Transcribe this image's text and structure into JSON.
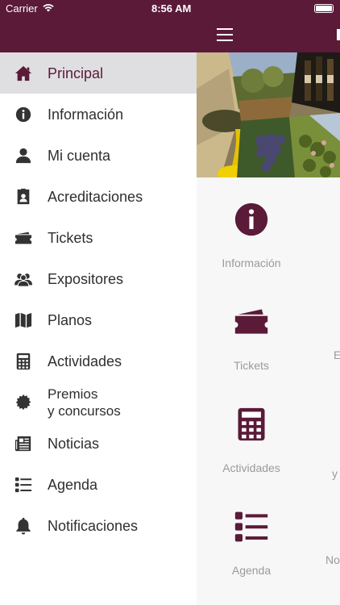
{
  "status_bar": {
    "carrier": "Carrier",
    "time": "8:56 AM"
  },
  "drawer": {
    "items": [
      {
        "label": "Principal",
        "icon": "home-icon",
        "active": true
      },
      {
        "label": "Información",
        "icon": "info-icon"
      },
      {
        "label": "Mi cuenta",
        "icon": "user-icon"
      },
      {
        "label": "Acreditaciones",
        "icon": "badge-icon"
      },
      {
        "label": "Tickets",
        "icon": "ticket-icon"
      },
      {
        "label": "Expositores",
        "icon": "group-icon"
      },
      {
        "label": "Planos",
        "icon": "map-icon"
      },
      {
        "label": "Actividades",
        "icon": "calculator-icon"
      },
      {
        "label_line1": "Premios",
        "label_line2": "y concursos",
        "icon": "award-icon"
      },
      {
        "label": "Noticias",
        "icon": "newspaper-icon"
      },
      {
        "label": "Agenda",
        "icon": "list-icon"
      },
      {
        "label": "Notificaciones",
        "icon": "bell-icon"
      }
    ]
  },
  "main": {
    "tiles": [
      {
        "label": "Información",
        "icon": "info-icon"
      },
      {
        "label": "Tickets",
        "icon": "ticket-icon"
      },
      {
        "label": "Actividades",
        "icon": "calculator-icon"
      },
      {
        "label": "Agenda",
        "icon": "list-icon"
      }
    ],
    "edge_fragments": [
      "E",
      "y",
      "No"
    ]
  },
  "colors": {
    "brand": "#5a1a38",
    "active_row": "#dfdfe1",
    "tile_label": "#9a9a9a"
  }
}
